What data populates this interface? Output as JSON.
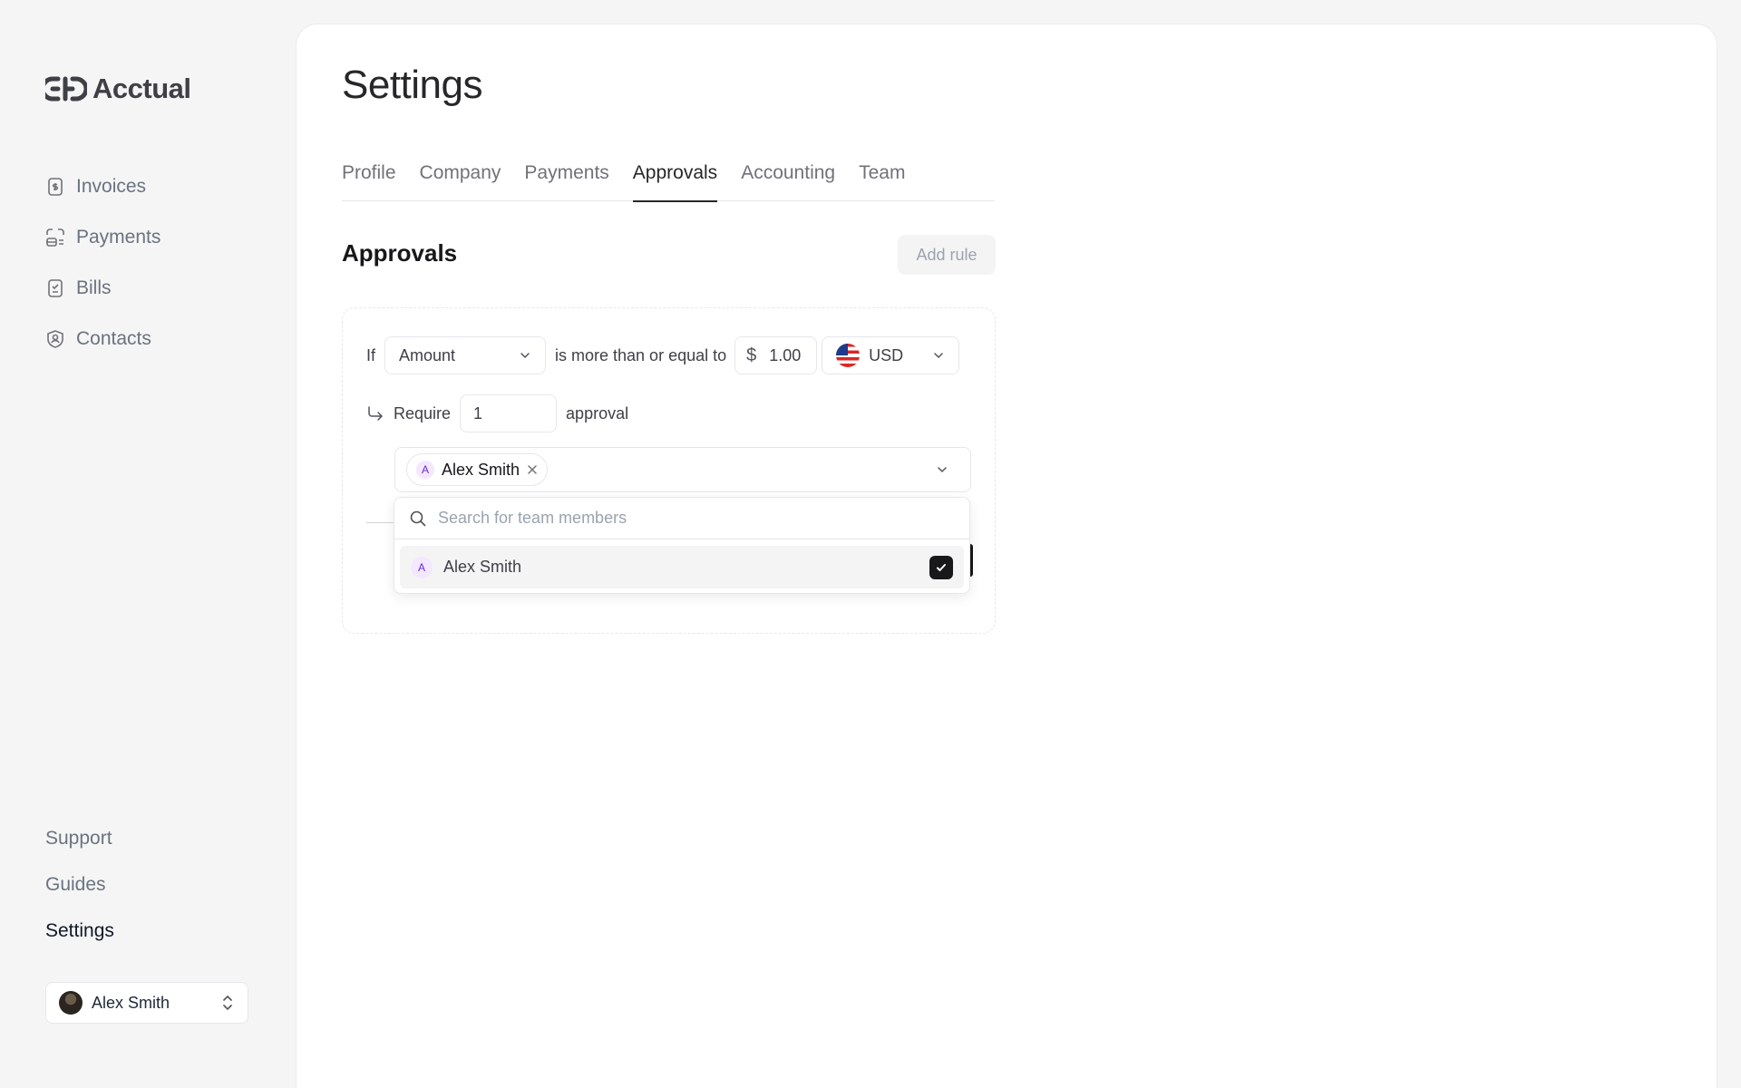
{
  "brand": {
    "name": "Acctual"
  },
  "sidebar": {
    "items": [
      {
        "label": "Invoices",
        "icon": "invoice-icon"
      },
      {
        "label": "Payments",
        "icon": "payments-icon"
      },
      {
        "label": "Bills",
        "icon": "bills-icon"
      },
      {
        "label": "Contacts",
        "icon": "contacts-icon"
      }
    ],
    "bottom": [
      {
        "label": "Support",
        "active": false
      },
      {
        "label": "Guides",
        "active": false
      },
      {
        "label": "Settings",
        "active": true
      }
    ],
    "user": {
      "name": "Alex Smith"
    }
  },
  "page": {
    "title": "Settings",
    "tabs": [
      {
        "label": "Profile"
      },
      {
        "label": "Company"
      },
      {
        "label": "Payments"
      },
      {
        "label": "Approvals",
        "active": true
      },
      {
        "label": "Accounting"
      },
      {
        "label": "Team"
      }
    ],
    "section_title": "Approvals",
    "add_rule_label": "Add rule"
  },
  "rule": {
    "if_label": "If",
    "field_value": "Amount",
    "operator_text": "is more than or equal to",
    "currency_symbol": "$",
    "amount_value": "1.00",
    "currency_code": "USD",
    "require_label": "Require",
    "approval_count": "1",
    "approval_label": "approval",
    "approver_chip": {
      "initial": "A",
      "name": "Alex Smith"
    }
  },
  "dropdown": {
    "search_placeholder": "Search for team members",
    "options": [
      {
        "initial": "A",
        "name": "Alex Smith",
        "checked": true
      }
    ]
  },
  "colors": {
    "accent": "#18181b",
    "avatar_bg": "#f3e8ff",
    "avatar_fg": "#6d28d9"
  }
}
